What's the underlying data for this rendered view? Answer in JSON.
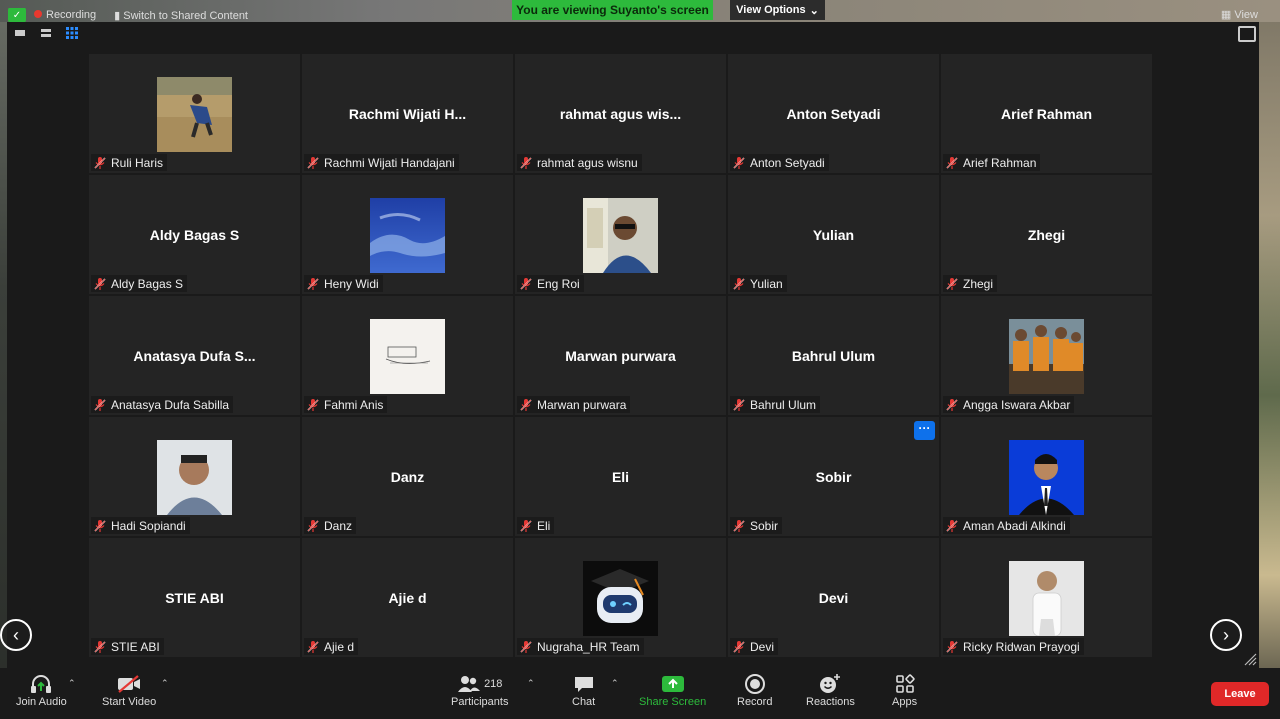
{
  "topbar": {
    "recording_label": "Recording",
    "switch_label": "Switch to Shared Content",
    "viewing_text": "You are viewing Suyanto's screen",
    "view_options_label": "View Options",
    "view_label": "View"
  },
  "participants": [
    {
      "display": "",
      "label": "Ruli Haris",
      "avatar": "photo-field"
    },
    {
      "display": "Rachmi  Wijati  H...",
      "label": "Rachmi Wijati Handajani"
    },
    {
      "display": "rahmat  agus  wis...",
      "label": "rahmat agus wisnu"
    },
    {
      "display": "Anton Setyadi",
      "label": "Anton Setyadi"
    },
    {
      "display": "Arief Rahman",
      "label": "Arief Rahman"
    },
    {
      "display": "Aldy Bagas S",
      "label": "Aldy Bagas S"
    },
    {
      "display": "",
      "label": "Heny Widi",
      "avatar": "photo-sky"
    },
    {
      "display": "",
      "label": "Eng Roi",
      "avatar": "photo-man-office"
    },
    {
      "display": "Yulian",
      "label": "Yulian"
    },
    {
      "display": "Zhegi",
      "label": "Zhegi"
    },
    {
      "display": "Anatasya  Dufa  S...",
      "label": "Anatasya Dufa Sabilla"
    },
    {
      "display": "",
      "label": "Fahmi Anis",
      "avatar": "photo-sketch"
    },
    {
      "display": "Marwan purwara",
      "label": "Marwan purwara"
    },
    {
      "display": "Bahrul Ulum",
      "label": "Bahrul Ulum"
    },
    {
      "display": "",
      "label": "Angga Iswara Akbar",
      "avatar": "photo-group"
    },
    {
      "display": "",
      "label": "Hadi Sopiandi",
      "avatar": "photo-man-portrait"
    },
    {
      "display": "Danz",
      "label": "Danz"
    },
    {
      "display": "Eli",
      "label": "Eli"
    },
    {
      "display": "Sobir",
      "label": "Sobir"
    },
    {
      "display": "",
      "label": "Aman Abadi Alkindi",
      "avatar": "photo-blue-suit"
    },
    {
      "display": "STIE ABI",
      "label": "STIE ABI"
    },
    {
      "display": "Ajie d",
      "label": "Ajie d"
    },
    {
      "display": "",
      "label": "Nugraha_HR Team",
      "avatar": "photo-robot-graduate"
    },
    {
      "display": "Devi",
      "label": "Devi"
    },
    {
      "display": "",
      "label": "Ricky Ridwan Prayogi",
      "avatar": "photo-man-white-shirt"
    }
  ],
  "more_button_label": "···",
  "toolbar": {
    "join_audio": "Join Audio",
    "start_video": "Start Video",
    "participants": "Participants",
    "participants_count": "218",
    "chat": "Chat",
    "share_screen": "Share Screen",
    "record": "Record",
    "reactions": "Reactions",
    "apps": "Apps",
    "leave": "Leave"
  },
  "colors": {
    "share_green": "#2dba3c",
    "leave_red": "#e02828",
    "muted_red": "#e53935",
    "more_blue": "#0e71eb"
  }
}
